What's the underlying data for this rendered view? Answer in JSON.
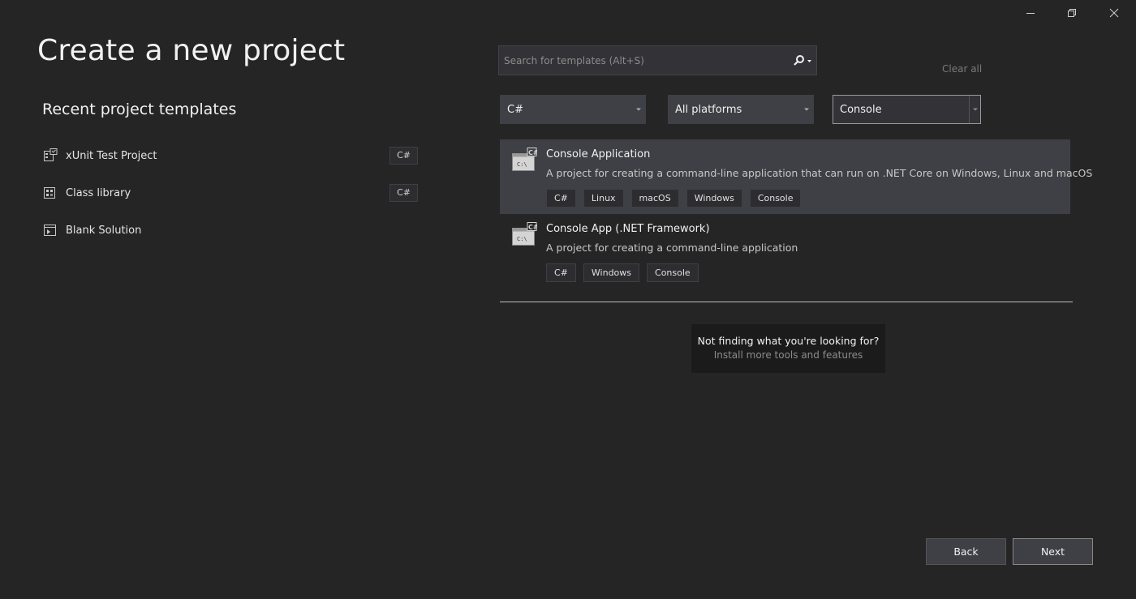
{
  "window": {
    "minimize_icon": "minimize-icon",
    "restore_icon": "restore-icon",
    "close_icon": "close-icon"
  },
  "page_title": "Create a new project",
  "recent": {
    "heading": "Recent project templates",
    "items": [
      {
        "label": "xUnit Test Project",
        "tag": "C#",
        "icon": "test-project-icon"
      },
      {
        "label": "Class library",
        "tag": "C#",
        "icon": "class-library-icon"
      },
      {
        "label": "Blank Solution",
        "tag": "",
        "icon": "blank-solution-icon"
      }
    ]
  },
  "search": {
    "placeholder": "Search for templates (Alt+S)",
    "value": "",
    "icon": "search-icon"
  },
  "clear_all": "Clear all",
  "filters": {
    "language": "C#",
    "platform": "All platforms",
    "project_type": "Console"
  },
  "templates": [
    {
      "title": "Console Application",
      "description": "A project for creating a command-line application that can run on .NET Core on Windows, Linux and macOS",
      "tags": [
        "C#",
        "Linux",
        "macOS",
        "Windows",
        "Console"
      ],
      "selected": true,
      "icon": "console-app-icon"
    },
    {
      "title": "Console App (.NET Framework)",
      "description": "A project for creating a command-line application",
      "tags": [
        "C#",
        "Windows",
        "Console"
      ],
      "selected": false,
      "icon": "console-app-icon"
    }
  ],
  "not_finding": {
    "text": "Not finding what you're looking for?",
    "link": "Install more tools and features"
  },
  "buttons": {
    "back": "Back",
    "next": "Next"
  },
  "colors": {
    "background": "#252526",
    "selected_card": "#3f3f46",
    "control": "#3f3f46",
    "text": "#f1f1f1",
    "muted": "#8c8c8c"
  }
}
